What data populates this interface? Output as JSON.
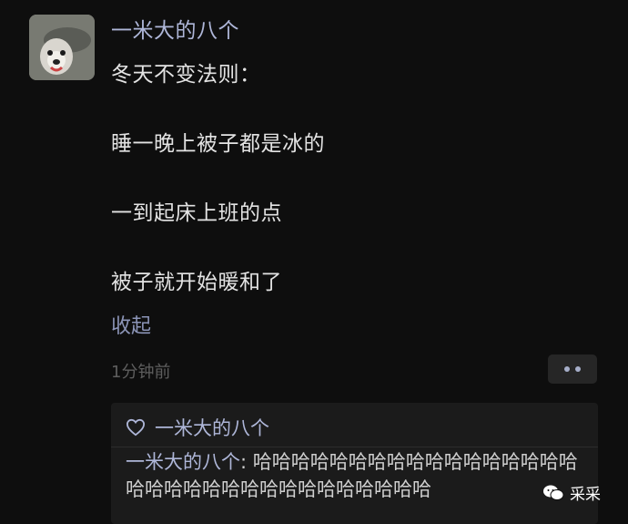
{
  "post": {
    "author": "一米大的八个",
    "lines": [
      "冬天不变法则：",
      "睡一晚上被子都是冰的",
      "一到起床上班的点",
      "被子就开始暖和了"
    ],
    "collapse_label": "收起",
    "time": "1分钟前"
  },
  "likes": {
    "name": "一米大的八个"
  },
  "comment": {
    "author": "一米大的八个",
    "separator": ": ",
    "text": "哈哈哈哈哈哈哈哈哈哈哈哈哈哈哈哈哈哈哈哈哈哈哈哈哈哈哈哈哈哈哈哈哈"
  },
  "watermark": {
    "label": "采采"
  },
  "colors": {
    "background": "#0e0e0e",
    "name": "#aeb6d8",
    "panel": "#1b1b1b"
  }
}
